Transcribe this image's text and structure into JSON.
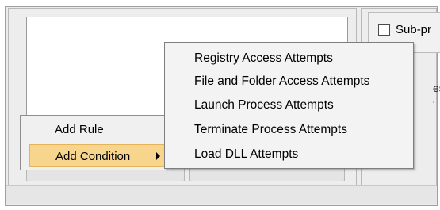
{
  "right_panel": {
    "checkbox_label": "Sub-pr",
    "fragment_1": "es",
    "fragment_2": "'"
  },
  "context_menu": {
    "items": [
      {
        "label": "Add Rule"
      },
      {
        "label": "Add Condition",
        "has_submenu": true,
        "highlighted": true
      }
    ],
    "highlight_color": "#f7d58c"
  },
  "submenu": {
    "items": [
      {
        "label": "Registry Access Attempts"
      },
      {
        "label": "File and Folder Access Attempts"
      },
      {
        "label": "Launch Process Attempts"
      },
      {
        "label": "Terminate Process Attempts"
      },
      {
        "label": "Load DLL Attempts"
      }
    ]
  },
  "icons": {
    "submenu_arrow": "chevron-right-icon"
  }
}
